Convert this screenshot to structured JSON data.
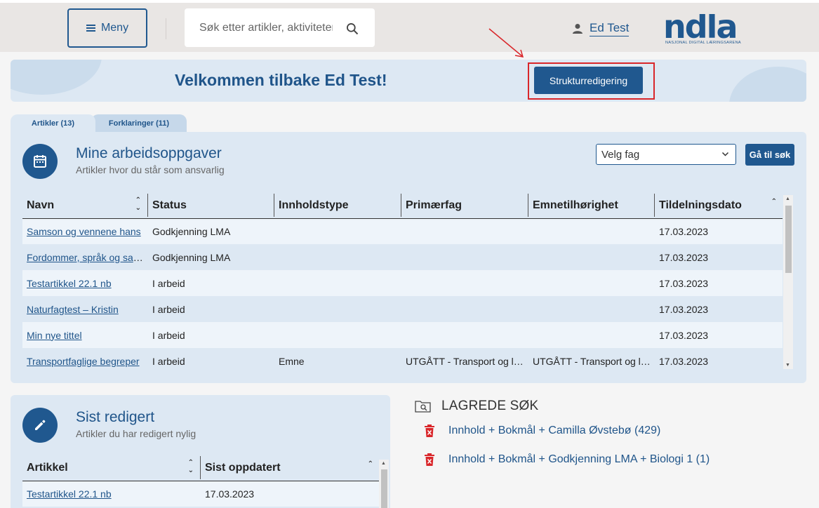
{
  "header": {
    "menu_label": "Meny",
    "search_placeholder": "Søk etter artikler, aktiviteter",
    "user_name": "Ed Test",
    "logo_text": "ndla",
    "logo_tagline": "NASJONAL DIGITAL LÆRINGSARENA"
  },
  "welcome": {
    "title": "Velkommen tilbake Ed Test!",
    "structure_button": "Strukturredigering"
  },
  "tabs": [
    {
      "label": "Artikler (13)",
      "active": true
    },
    {
      "label": "Forklaringer (11)",
      "active": false
    }
  ],
  "tasks": {
    "title": "Mine arbeidsoppgaver",
    "subtitle": "Artikler hvor du står som ansvarlig",
    "subject_select": "Velg fag",
    "goto_search": "Gå til søk",
    "columns": [
      "Navn",
      "Status",
      "Innholdstype",
      "Primærfag",
      "Emnetilhørighet",
      "Tildelningsdato"
    ],
    "rows": [
      {
        "name": "Samson og vennene hans",
        "status": "Godkjenning LMA",
        "type": "",
        "subject": "",
        "topic": "",
        "date": "17.03.2023"
      },
      {
        "name": "Fordommer, språk og samfunn",
        "status": "Godkjenning LMA",
        "type": "",
        "subject": "",
        "topic": "",
        "date": "17.03.2023"
      },
      {
        "name": "Testartikkel 22.1 nb",
        "status": "I arbeid",
        "type": "",
        "subject": "",
        "topic": "",
        "date": "17.03.2023"
      },
      {
        "name": "Naturfagtest – Kristin",
        "status": "I arbeid",
        "type": "",
        "subject": "",
        "topic": "",
        "date": "17.03.2023"
      },
      {
        "name": "Min nye tittel",
        "status": "I arbeid",
        "type": "",
        "subject": "",
        "topic": "",
        "date": "17.03.2023"
      },
      {
        "name": "Transportfaglige begreper",
        "status": "I arbeid",
        "type": "Emne",
        "subject": "UTGÅTT - Transport og logistikk",
        "topic": "UTGÅTT - Transport og logistikk",
        "date": "17.03.2023"
      }
    ]
  },
  "recent": {
    "title": "Sist redigert",
    "subtitle": "Artikler du har redigert nylig",
    "columns": [
      "Artikkel",
      "Sist oppdatert"
    ],
    "rows": [
      {
        "name": "Testartikkel 22.1 nb",
        "date": "17.03.2023"
      }
    ]
  },
  "saved_searches": {
    "title": "LAGREDE SØK",
    "items": [
      "Innhold + Bokmål + Camilla Øvstebø (429)",
      "Innhold + Bokmål + Godkjenning LMA + Biologi 1 (1)"
    ]
  },
  "colors": {
    "primary": "#20588f",
    "card_bg": "#dde8f3",
    "highlight": "#d9262a",
    "delete": "#d9262a"
  }
}
